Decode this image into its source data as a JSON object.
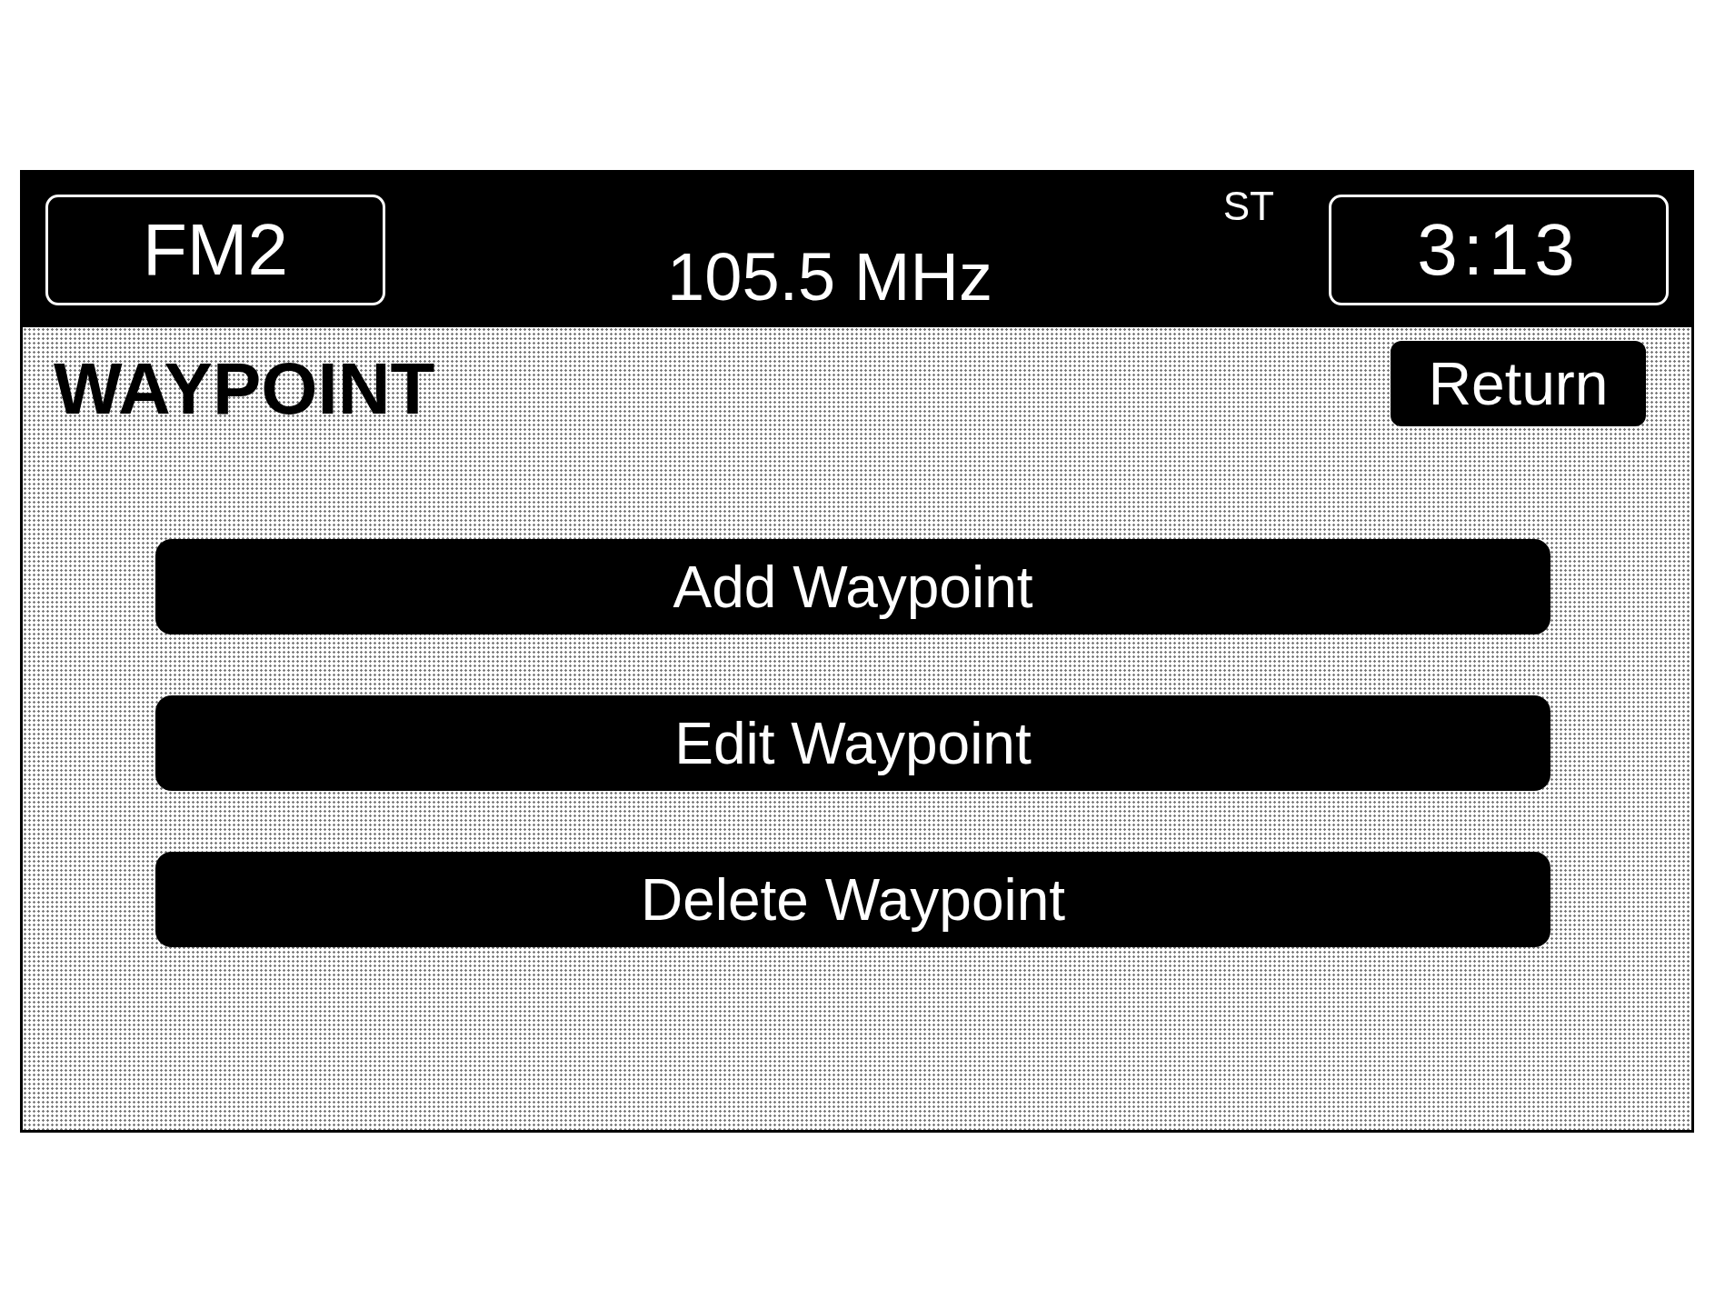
{
  "header": {
    "band": "FM2",
    "stereo": "ST",
    "frequency": "105.5 MHz",
    "time": "3:13"
  },
  "screen": {
    "title": "WAYPOINT",
    "return_button": "Return",
    "menu": [
      {
        "label": "Add Waypoint"
      },
      {
        "label": "Edit Waypoint"
      },
      {
        "label": "Delete Waypoint"
      }
    ]
  }
}
